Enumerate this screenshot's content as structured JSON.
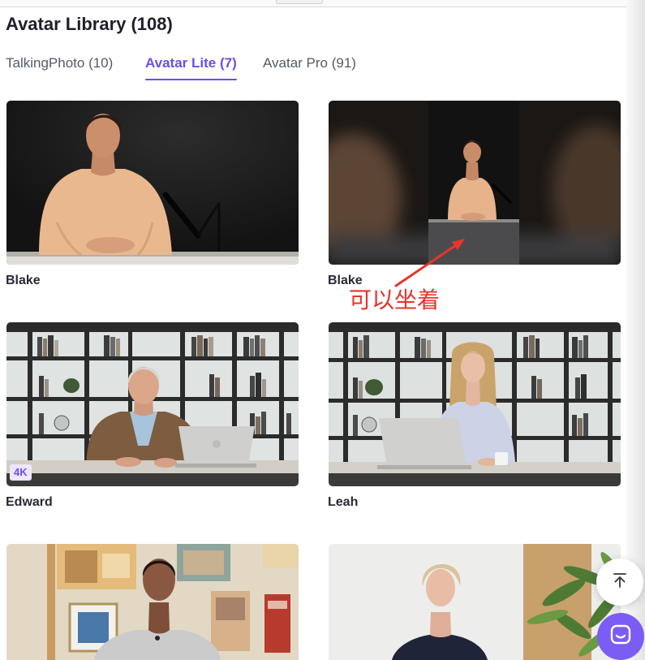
{
  "header": {
    "title": "Avatar Library (108)"
  },
  "tabs": [
    {
      "label": "TalkingPhoto (10)",
      "active": false
    },
    {
      "label": "Avatar Lite (7)",
      "active": true
    },
    {
      "label": "Avatar Pro (91)",
      "active": false
    }
  ],
  "avatars": [
    {
      "name": "Blake"
    },
    {
      "name": "Blake"
    },
    {
      "name": "Edward",
      "badge": "4K"
    },
    {
      "name": "Leah"
    },
    {},
    {}
  ],
  "annotation": {
    "text": "可以坐着",
    "color": "#e8342a"
  },
  "floating_buttons": {
    "scroll_top_icon": "arrow-up-to-line-icon",
    "chat_icon": "chat-bubble-icon"
  },
  "colors": {
    "accent": "#6c4ef0",
    "chat_button": "#7b5cf5",
    "badge_bg": "#ece6ff"
  }
}
